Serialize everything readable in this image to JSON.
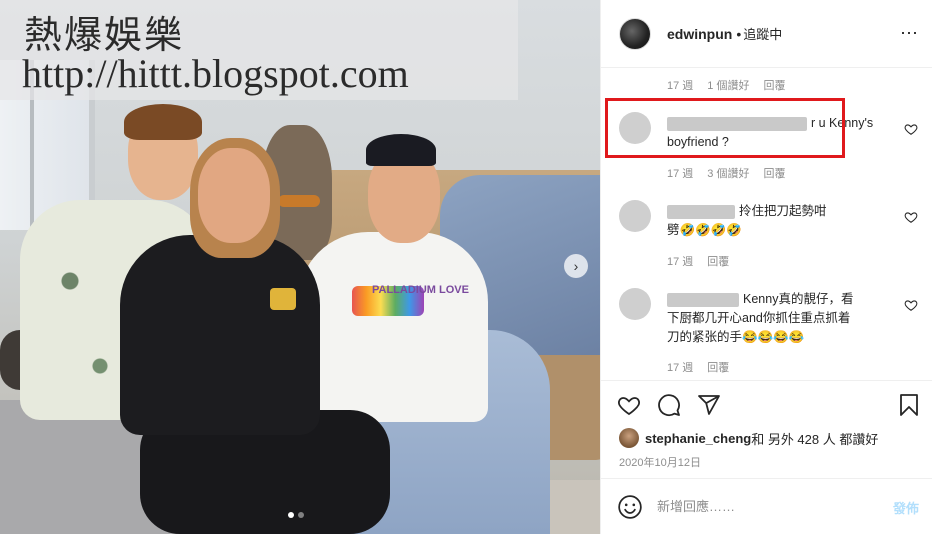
{
  "watermark": {
    "line1": "熱爆娛樂",
    "line2": "http://hittt.blogspot.com"
  },
  "photo": {
    "shirt_print": "PALLADIUM LOVE",
    "carousel_next": "›",
    "carousel_total": 2,
    "carousel_active": 1
  },
  "header": {
    "username": "edwinpun",
    "separator": "•",
    "status": "追蹤中",
    "more_icon": "⋯"
  },
  "thread_top_meta": {
    "time": "17 週",
    "likes": "1 個讚好",
    "reply": "回覆"
  },
  "comments": [
    {
      "text_line1": "r u Kenny's",
      "text_line2": "boyfriend ?",
      "time": "17 週",
      "likes": "3 個讚好",
      "reply": "回覆"
    },
    {
      "text_line1": "拎住把刀起勢咁",
      "text_line2": "劈🤣🤣🤣🤣",
      "time": "17 週",
      "reply": "回覆"
    },
    {
      "text_line1": "Kenny真的靚仔，看",
      "text_line2": "下厨都几开心and你抓住重点抓着",
      "text_line3": "刀的紧张的手😂😂😂😂",
      "time": "17 週",
      "reply": "回覆"
    }
  ],
  "likes": {
    "user": "stephanie_cheng",
    "rest": " 和 另外 428 人 都讚好"
  },
  "date": "2020年10月12日",
  "add_comment": {
    "placeholder": "新增回應……",
    "post_label": "發佈"
  },
  "icons": [
    "heart-icon",
    "comment-icon",
    "share-icon",
    "bookmark-icon",
    "emoji-icon",
    "more-icon"
  ],
  "colors": {
    "highlight": "#e0191c",
    "post_button": "#b2dffc",
    "meta_text": "#8e8e8e"
  }
}
